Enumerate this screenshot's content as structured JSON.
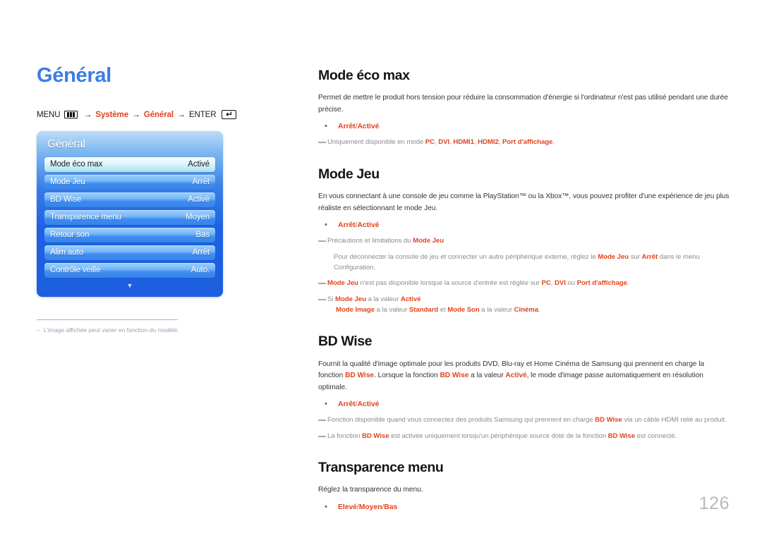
{
  "page": {
    "title": "Général",
    "number": "126",
    "accent_color": "#e0441f",
    "title_color": "#3c7ce4"
  },
  "breadcrumb": {
    "menu_label": "MENU",
    "menu_icon": "menu-bars-icon",
    "arrow": "→",
    "step1": "Système",
    "step2": "Général",
    "enter_label": "ENTER",
    "enter_icon": "enter-key-icon"
  },
  "osd": {
    "title": "Général",
    "scroll_icon": "chevron-down-icon",
    "rows": [
      {
        "label": "Mode éco max",
        "value": "Activé",
        "selected": true
      },
      {
        "label": "Mode Jeu",
        "value": "Arrêt",
        "selected": false
      },
      {
        "label": "BD Wise",
        "value": "Activé",
        "selected": false
      },
      {
        "label": "Transparence menu",
        "value": "Moyen",
        "selected": false
      },
      {
        "label": "Retour son",
        "value": "Bas",
        "selected": false
      },
      {
        "label": "Alim auto",
        "value": "Arrêt",
        "selected": false
      },
      {
        "label": "Contrôle veille",
        "value": "Auto.",
        "selected": false
      }
    ]
  },
  "footnote": {
    "dash": "‒",
    "text": "L'image affichée peut varier en fonction du modèle."
  },
  "sections": {
    "eco": {
      "title": "Mode éco max",
      "paragraph": "Permet de mettre le produit hors tension pour réduire la consommation d'énergie si l'ordinateur n'est pas utilisé pendant une durée précise.",
      "bullet_dot": "•",
      "bullet_a": "Arrêt",
      "bullet_sep": " / ",
      "bullet_b": "Activé",
      "note_pre": "Uniquement disponible en mode ",
      "note_v1": "PC",
      "note_v2": "DVI",
      "note_v3": "HDMI1",
      "note_v4": "HDMI2",
      "note_v5": "Port d'affichage",
      "note_end": "."
    },
    "jeu": {
      "title": "Mode Jeu",
      "paragraph": "En vous connectant à une console de jeu comme la PlayStation™ ou la Xbox™, vous pouvez profiter d'une expérience de jeu plus réaliste en sélectionnant le mode Jeu.",
      "bullet_dot": "•",
      "bullet_a": "Arrêt",
      "bullet_sep": " / ",
      "bullet_b": "Activé",
      "note1_pre": "Précautions et limitations du ",
      "note1_acc": "Mode Jeu",
      "note1_sub_a": "Pour déconnecter la console de jeu et connecter un autre périphérique externe, réglez le ",
      "note1_sub_acc1": "Mode Jeu",
      "note1_sub_b": " sur ",
      "note1_sub_acc2": "Arrêt",
      "note1_sub_c": " dans le menu Configuration.",
      "note2_acc1": "Mode Jeu",
      "note2_a": " n'est pas disponible lorsque la source d'entrée est réglée sur ",
      "note2_acc2": "PC",
      "note2_b": ", ",
      "note2_acc3": "DVI",
      "note2_c": " ou ",
      "note2_acc4": "Port d'affichage",
      "note2_d": ".",
      "note3_a": "Si ",
      "note3_acc1": "Mode Jeu",
      "note3_b": " a la valeur ",
      "note3_acc2": "Activé",
      "note3_l2_acc1": "Mode Image",
      "note3_l2_a": " a la valeur ",
      "note3_l2_acc2": "Standard",
      "note3_l2_b": " et ",
      "note3_l2_acc3": "Mode Son",
      "note3_l2_c": " a la valeur ",
      "note3_l2_acc4": "Cinéma",
      "note3_l2_d": "."
    },
    "bdwise": {
      "title": "BD Wise",
      "para_a": "Fournit la qualité d'image optimale pour les produits DVD, Blu-ray et Home Cinéma de Samsung qui prennent en charge la fonction ",
      "para_acc1": "BD Wise",
      "para_b": ". Lorsque la fonction ",
      "para_acc2": "BD Wise",
      "para_c": " a la valeur ",
      "para_acc3": "Activé",
      "para_d": ", le mode d'image passe automatiquement en résolution optimale.",
      "bullet_dot": "•",
      "bullet_a": "Arrêt",
      "bullet_sep": " / ",
      "bullet_b": "Activé",
      "note1_a": "Fonction disponible quand vous connectez des produits Samsung qui prennent en charge ",
      "note1_acc": "BD Wise",
      "note1_b": " via un câble HDMI relié au produit.",
      "note2_a": "La fonction ",
      "note2_acc1": "BD Wise",
      "note2_b": " est activée uniquement lorsqu'un périphérique source doté de la fonction ",
      "note2_acc2": "BD Wise",
      "note2_c": " est connecté."
    },
    "transparence": {
      "title": "Transparence menu",
      "paragraph": "Réglez la transparence du menu.",
      "bullet_dot": "•",
      "bullet_a": "Elevé",
      "bullet_sep1": " / ",
      "bullet_b": "Moyen",
      "bullet_sep2": " / ",
      "bullet_c": "Bas"
    }
  }
}
